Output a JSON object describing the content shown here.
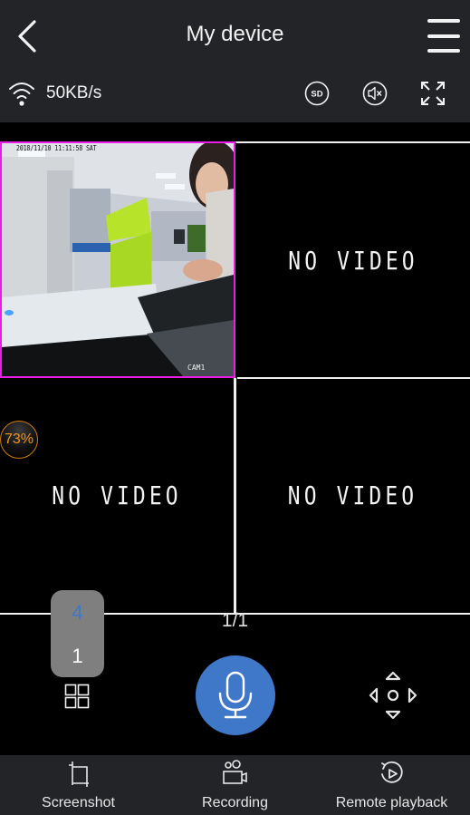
{
  "header": {
    "title": "My device",
    "back_icon": "chevron-left-icon",
    "menu_icon": "hamburger-menu-icon"
  },
  "status": {
    "network_icon": "wifi-icon",
    "speed": "50KB/s",
    "controls": [
      {
        "name": "sd-quality",
        "icon": "sd-icon",
        "label": "SD"
      },
      {
        "name": "mute",
        "icon": "speaker-muted-icon"
      },
      {
        "name": "fullscreen",
        "icon": "fullscreen-expand-icon"
      }
    ]
  },
  "video_grid": {
    "layout": 4,
    "selected_channel": 1,
    "highlight_color": "#e81ee8",
    "channels": [
      {
        "id": 1,
        "state": "live",
        "timestamp": "2018/11/10 11:11:58 SAT",
        "label": "CAM1"
      },
      {
        "id": 2,
        "state": "no_video",
        "text": "NO VIDEO"
      },
      {
        "id": 3,
        "state": "no_video",
        "text": "NO VIDEO"
      },
      {
        "id": 4,
        "state": "no_video",
        "text": "NO VIDEO"
      }
    ]
  },
  "battery": {
    "percent": 73,
    "text": "73%",
    "color": "#f29418"
  },
  "pagination": {
    "text": "1/1",
    "current": 1,
    "total": 1
  },
  "layout_picker": {
    "options": [
      {
        "value": "4",
        "selected": true
      },
      {
        "value": "1",
        "selected": false
      }
    ],
    "selected_color": "#3f78c9",
    "icon": "grid-four-icon"
  },
  "talk": {
    "icon": "microphone-icon",
    "color": "#3f78c9"
  },
  "ptz": {
    "icon": "ptz-direction-pad-icon"
  },
  "toolbar": {
    "items": [
      {
        "label": "Screenshot",
        "icon": "crop-icon"
      },
      {
        "label": "Recording",
        "icon": "video-camera-icon"
      },
      {
        "label": "Remote playback",
        "icon": "replay-icon"
      }
    ]
  }
}
